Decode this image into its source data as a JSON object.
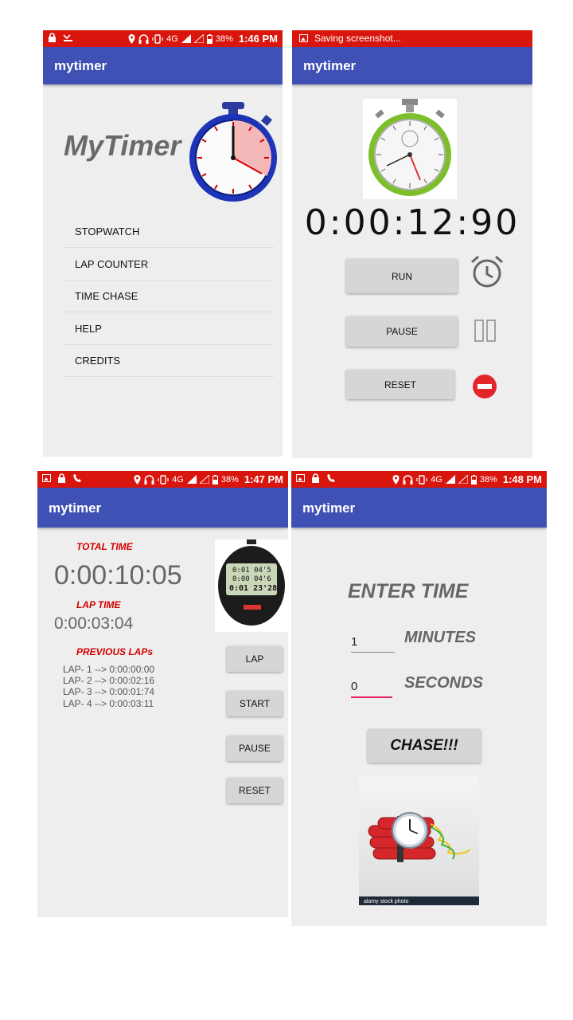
{
  "colors": {
    "status_bar": "#d9160e",
    "app_bar": "#3f51b5",
    "accent_red": "#d50000",
    "pink_focus": "#e91e63"
  },
  "screen1": {
    "status": {
      "battery": "38%",
      "network": "4G",
      "time": "1:46 PM"
    },
    "app_title": "mytimer",
    "logo_text": "MyTimer",
    "menu": [
      {
        "label": "STOPWATCH"
      },
      {
        "label": "LAP COUNTER"
      },
      {
        "label": "TIME CHASE"
      },
      {
        "label": "HELP"
      },
      {
        "label": "CREDITS"
      }
    ]
  },
  "screen2": {
    "status": {
      "message": "Saving screenshot..."
    },
    "app_title": "mytimer",
    "timer": "0:00:12:90",
    "buttons": {
      "run": "RUN",
      "pause": "PAUSE",
      "reset": "RESET"
    },
    "icons": {
      "run": "alarm-clock-icon",
      "pause": "pause-icon",
      "reset": "stop-icon"
    }
  },
  "screen3": {
    "status": {
      "battery": "38%",
      "network": "4G",
      "time": "1:47 PM"
    },
    "app_title": "mytimer",
    "total_time_label": "TOTAL TIME",
    "total_time": "0:00:10:05",
    "lap_time_label": "LAP TIME",
    "lap_time": "0:00:03:04",
    "previous_laps_label": "PREVIOUS LAPs",
    "laps": [
      "LAP- 1 --> 0:00:00:00",
      "LAP- 2 --> 0:00:02:16",
      "LAP- 3 --> 0:00:01:74",
      "LAP- 4 --> 0:00:03:11"
    ],
    "buttons": {
      "lap": "LAP",
      "start": "START",
      "pause": "PAUSE",
      "reset": "RESET"
    },
    "stopwatch_display": [
      "0:01 04'5",
      "0:00 04'6",
      "0:01 23'28"
    ]
  },
  "screen4": {
    "status": {
      "battery": "38%",
      "network": "4G",
      "time": "1:48 PM"
    },
    "app_title": "mytimer",
    "enter_time_label": "ENTER TIME",
    "minutes_value": "1",
    "minutes_label": "MINUTES",
    "seconds_value": "0",
    "seconds_label": "SECONDS",
    "chase_button": "CHASE!!!",
    "image_caption": "alamy stock photo"
  }
}
